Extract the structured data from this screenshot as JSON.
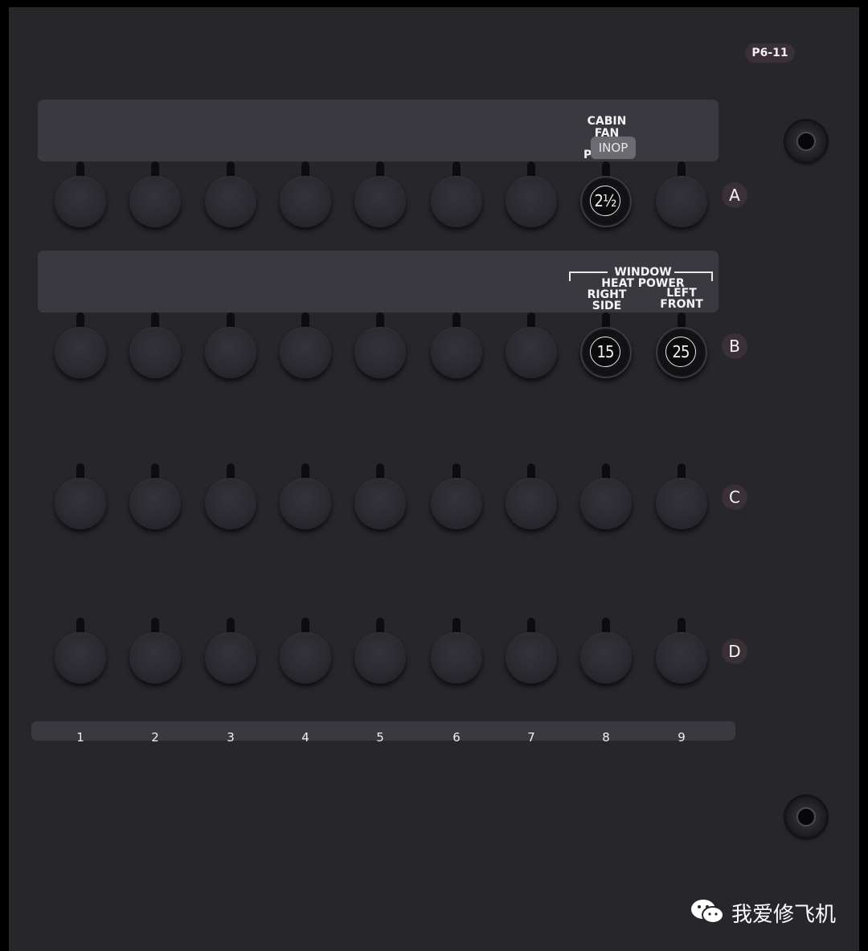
{
  "panel_id": "P6-11",
  "row_labels": [
    "A",
    "B",
    "C",
    "D"
  ],
  "column_labels": [
    "1",
    "2",
    "3",
    "4",
    "5",
    "6",
    "7",
    "8",
    "9"
  ],
  "breakers": {
    "A8": {
      "rating": "2½",
      "label_top": "CABIN",
      "label_mid": "FAN",
      "label_bottom": "POWER",
      "status": "INOP"
    },
    "B8": {
      "rating": "15",
      "label_line1": "RIGHT",
      "label_line2": "SIDE"
    },
    "B9": {
      "rating": "25",
      "label_line1": "LEFT",
      "label_line2": "FRONT"
    }
  },
  "group_label": {
    "line1": "WINDOW",
    "line2": "HEAT POWER"
  },
  "watermark": {
    "icon": "wechat-icon",
    "text": "我爱修飞机"
  }
}
